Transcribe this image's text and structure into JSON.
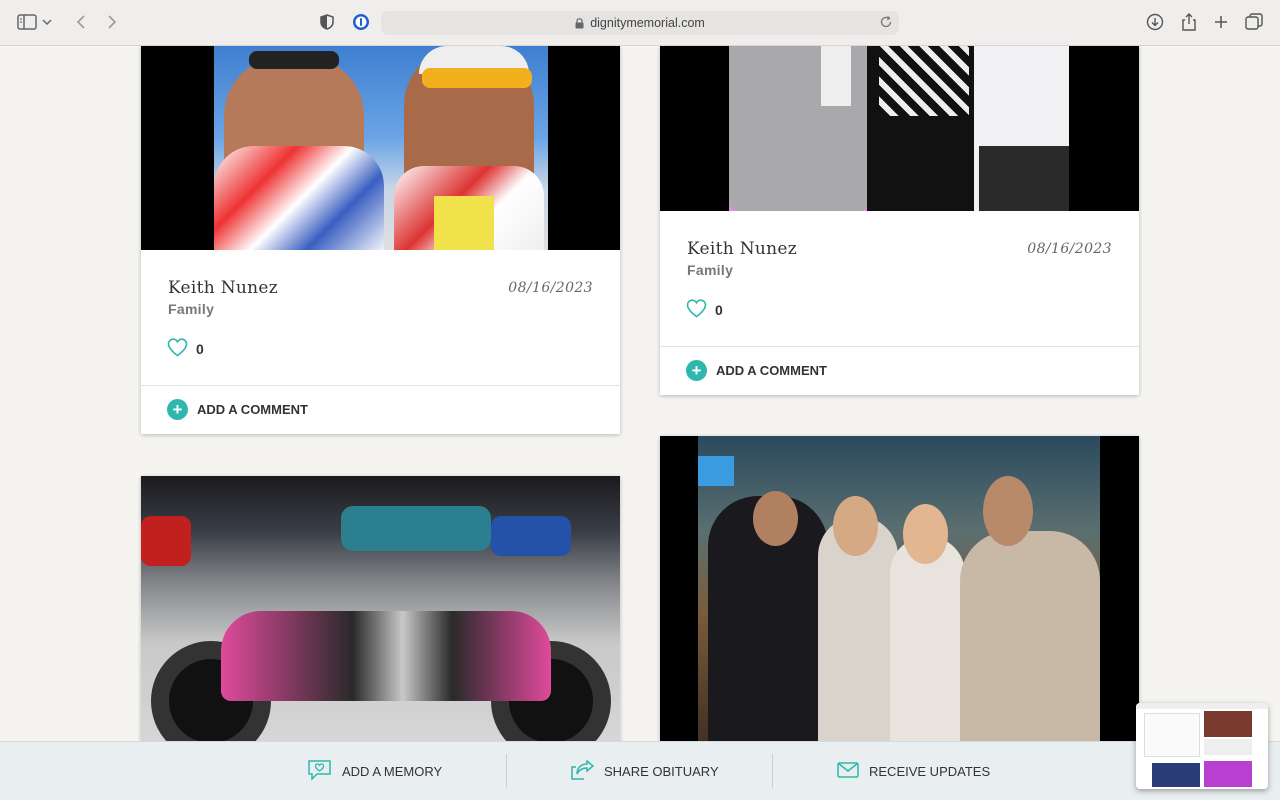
{
  "browser": {
    "url": "dignitymemorial.com"
  },
  "memories": [
    {
      "name": "Keith Nunez",
      "relation": "Family",
      "date": "08/16/2023",
      "likes": "0",
      "comment_label": "ADD A COMMENT"
    },
    {
      "name": "Keith Nunez",
      "relation": "Family",
      "date": "08/16/2023",
      "likes": "0",
      "comment_label": "ADD A COMMENT"
    }
  ],
  "bottom_bar": {
    "add_memory": "ADD A MEMORY",
    "share_obituary": "SHARE OBITUARY",
    "receive_updates": "RECEIVE UPDATES"
  },
  "colors": {
    "accent": "#2fb6ad",
    "page_bg": "#f5f4f1",
    "bar_bg": "#e9eef0"
  },
  "icons": {
    "like": "heart-icon",
    "comment": "plus-circle-icon",
    "memory": "speech-bubble-heart-icon",
    "share": "share-arrow-icon",
    "updates": "envelope-icon"
  }
}
